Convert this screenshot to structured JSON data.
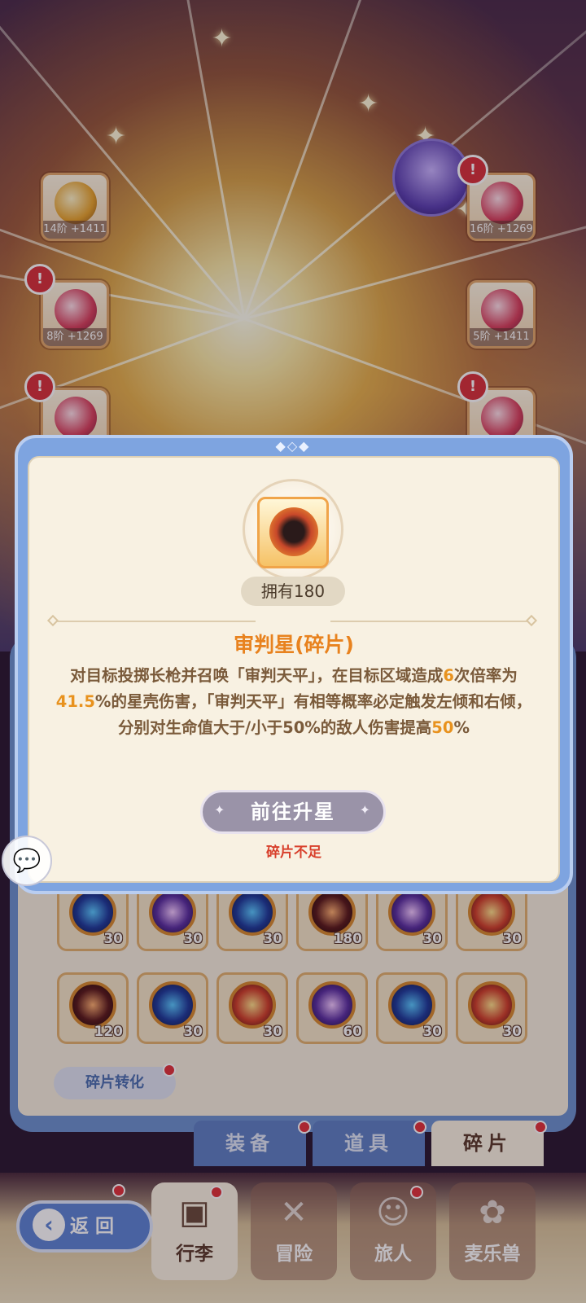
{
  "equipment_slots": [
    {
      "label": "14阶 +1411"
    },
    {
      "label": "16阶 +1269"
    },
    {
      "label": "8阶 +1269"
    },
    {
      "label": "5阶 +1411"
    }
  ],
  "modal": {
    "owned": "拥有180",
    "title": "审判星(碎片)",
    "desc": {
      "p1": "对目标投掷长枪并召唤「审判天平」，在目标区域造成",
      "hits": "6",
      "p2": "次倍率为",
      "rate": "41.5",
      "p3": "%的星壳伤害，「审判天平」有相等概率必定触发左倾和右倾，分别对生命值大于/小于50%的敌人伤害提高",
      "boost": "50",
      "p4": "%"
    },
    "button_label": "前往升星",
    "status": "碎片不足"
  },
  "inventory": {
    "row1_counts": [
      "30",
      "30",
      "30",
      "180",
      "30",
      "30"
    ],
    "row2_counts": [
      "120",
      "30",
      "30",
      "60",
      "30",
      "30"
    ],
    "convert_label": "碎片转化",
    "tabs": [
      "装备",
      "道具",
      "碎片"
    ]
  },
  "nav": {
    "back_label": "返回",
    "items": [
      "行李",
      "冒险",
      "旅人",
      "麦乐兽"
    ]
  },
  "colors": {
    "frame_blue": "#7ea4e0",
    "highlight_orange": "#e8921e",
    "warning_red": "#d8402c"
  }
}
